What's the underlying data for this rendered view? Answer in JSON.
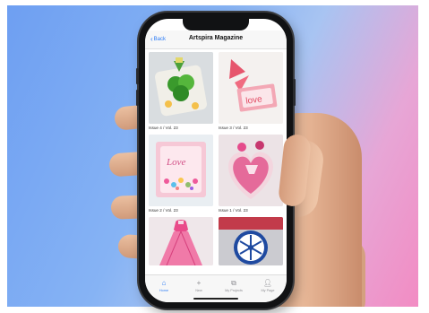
{
  "app": {
    "nav": {
      "back_label": "Back",
      "title": "Artspira Magazine"
    },
    "issues": [
      {
        "caption": "Issue 4 / Vol. 23",
        "art": "green-shamrock-coaster"
      },
      {
        "caption": "Issue 3 / Vol. 23",
        "art": "pink-love-card"
      },
      {
        "caption": "Issue 2 / Vol. 23",
        "art": "love-shaker-card"
      },
      {
        "caption": "Issue 1 / Vol. 23",
        "art": "pink-heart-pillow"
      },
      {
        "caption": "",
        "art": "paper-dress"
      },
      {
        "caption": "",
        "art": "snowflake-ornament"
      }
    ],
    "tabs": [
      {
        "label": "Home",
        "icon": "house-icon",
        "active": true
      },
      {
        "label": "New",
        "icon": "plus-icon",
        "active": false
      },
      {
        "label": "My Projects",
        "icon": "projects-icon",
        "active": false
      },
      {
        "label": "My Page",
        "icon": "person-icon",
        "active": false
      }
    ]
  },
  "colors": {
    "accent": "#2d7cf6",
    "inactive": "#8e8e93",
    "phone_body": "#111214"
  }
}
